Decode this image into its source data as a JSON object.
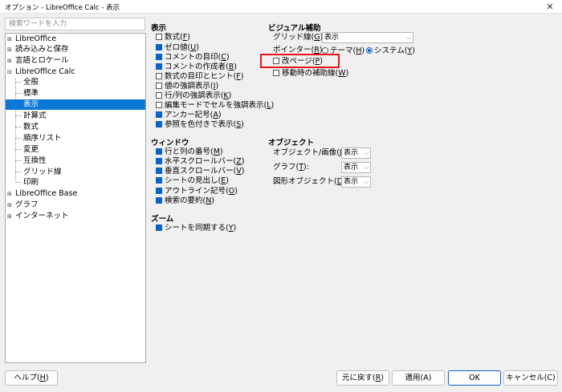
{
  "window": {
    "title": "オプション - LibreOffice Calc - 表示",
    "close_glyph": "✕"
  },
  "search": {
    "placeholder": "検索ワードを入力"
  },
  "tree": {
    "expander": "⊞",
    "expander_open": "⊟",
    "items": [
      {
        "label": "LibreOffice"
      },
      {
        "label": "読み込みと保存"
      },
      {
        "label": "言語とロケール"
      },
      {
        "label": "LibreOffice Calc"
      },
      {
        "label": "全般"
      },
      {
        "label": "標準"
      },
      {
        "label": "表示"
      },
      {
        "label": "計算式"
      },
      {
        "label": "数式"
      },
      {
        "label": "順序リスト"
      },
      {
        "label": "変更"
      },
      {
        "label": "互換性"
      },
      {
        "label": "グリッド線"
      },
      {
        "label": "印刷"
      },
      {
        "label": "LibreOffice Base"
      },
      {
        "label": "グラフ"
      },
      {
        "label": "インターネット"
      }
    ]
  },
  "display": {
    "title": "表示",
    "items": [
      {
        "pre": "数式(",
        "key": "F",
        "post": ")",
        "checked": false
      },
      {
        "pre": "ゼロ値(",
        "key": "U",
        "post": ")",
        "checked": true
      },
      {
        "pre": "コメントの目印(",
        "key": "C",
        "post": ")",
        "checked": true
      },
      {
        "pre": "コメントの作成者(",
        "key": "B",
        "post": ")",
        "checked": true
      },
      {
        "pre": "数式の目印とヒント(",
        "key": "F",
        "post": ")",
        "checked": false
      },
      {
        "pre": "値の強調表示(",
        "key": "I",
        "post": ")",
        "checked": false
      },
      {
        "pre": "行/列の強調表示(",
        "key": "K",
        "post": ")",
        "checked": false
      },
      {
        "pre": "編集モードでセルを強調表示(",
        "key": "L",
        "post": ")",
        "checked": false
      },
      {
        "pre": "アンカー記号(",
        "key": "A",
        "post": ")",
        "checked": true
      },
      {
        "pre": "参照を色付きで表示(",
        "key": "S",
        "post": ")",
        "checked": true
      }
    ]
  },
  "window_section": {
    "title": "ウィンドウ",
    "items": [
      {
        "pre": "行と列の番号(",
        "key": "M",
        "post": ")",
        "checked": true
      },
      {
        "pre": "水平スクロールバー(",
        "key": "Z",
        "post": ")",
        "checked": true
      },
      {
        "pre": "垂直スクロールバー(",
        "key": "V",
        "post": ")",
        "checked": true
      },
      {
        "pre": "シートの見出し(",
        "key": "E",
        "post": ")",
        "checked": true
      },
      {
        "pre": "アウトライン記号(",
        "key": "O",
        "post": ")",
        "checked": true
      },
      {
        "pre": "検索の要約(",
        "key": "N",
        "post": ")",
        "checked": true
      }
    ]
  },
  "zoom": {
    "title": "ズーム",
    "items": [
      {
        "pre": "シートを同期する(",
        "key": "Y",
        "post": ")",
        "checked": true
      }
    ]
  },
  "visual": {
    "title": "ビジュアル補助",
    "grid_label_pre": "グリッド線(",
    "grid_label_key": "G",
    "grid_label_post": "):",
    "grid_value": "表示",
    "pointer_label_pre": "ポインター(",
    "pointer_label_key": "R",
    "pointer_label_post": "):",
    "radio_theme_pre": "テーマ(",
    "radio_theme_key": "H",
    "radio_theme_post": ")",
    "radio_system_pre": "システム(",
    "radio_system_key": "Y",
    "radio_system_post": ")",
    "selected_pointer": "system",
    "items": [
      {
        "pre": "改ページ(",
        "key": "P",
        "post": ")",
        "checked": false
      },
      {
        "pre": "移動時の補助線(",
        "key": "W",
        "post": ")",
        "checked": false
      }
    ]
  },
  "objects": {
    "title": "オブジェクト",
    "rows": [
      {
        "pre": "オブジェクト/画像(",
        "key": "J",
        "post": "):",
        "value": "表示"
      },
      {
        "pre": "グラフ(",
        "key": "T",
        "post": "):",
        "value": "表示"
      },
      {
        "pre": "図形オブジェクト(",
        "key": "D",
        "post": "):",
        "value": "表示"
      }
    ]
  },
  "buttons": {
    "help_pre": "ヘルプ(",
    "help_key": "H",
    "help_post": ")",
    "reset_pre": "元に戻す(",
    "reset_key": "R",
    "reset_post": ")",
    "apply": "適用(A)",
    "ok": "OK",
    "cancel": "キャンセル(C)"
  },
  "dropdown_arrow": "⌵",
  "colors": {
    "accent": "#0a78d7",
    "checkbox": "#0a63c9",
    "highlight": "#e8121c"
  }
}
